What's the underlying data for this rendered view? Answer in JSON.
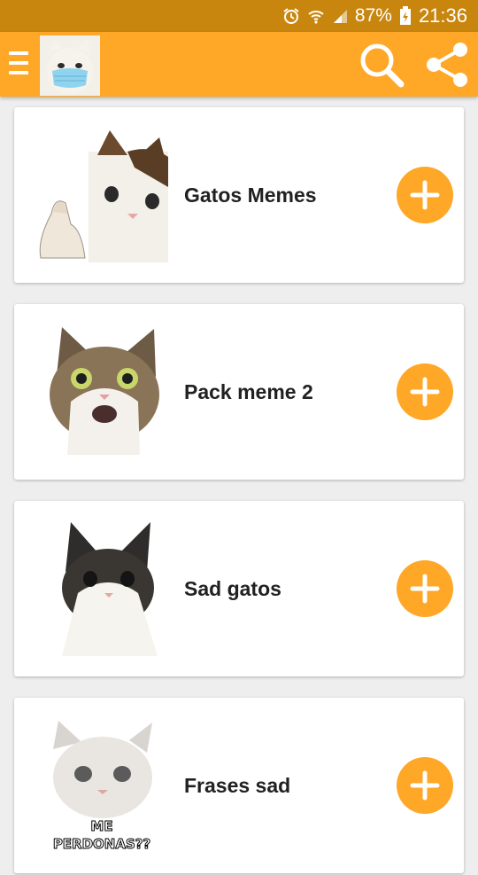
{
  "status_bar": {
    "battery": "87%",
    "time": "21:36",
    "icons": [
      "alarm-icon",
      "wifi-icon",
      "signal-icon",
      "battery-charging-icon"
    ]
  },
  "toolbar": {
    "icons": [
      "menu-icon",
      "search-icon",
      "share-icon"
    ],
    "background": "#ffa726"
  },
  "packs": [
    {
      "name": "Gatos Memes",
      "icon": "cat-thumbs-up-icon"
    },
    {
      "name": "Pack meme 2",
      "icon": "surprised-cat-icon"
    },
    {
      "name": "Sad gatos",
      "icon": "sad-cat-icon"
    },
    {
      "name": "Frases sad",
      "icon": "crying-white-cat-icon",
      "caption": "ME PERDONAS??"
    }
  ],
  "colors": {
    "accent": "#ffa726",
    "status_bar": "#c8860f",
    "background": "#eeeeee",
    "card": "#ffffff"
  }
}
